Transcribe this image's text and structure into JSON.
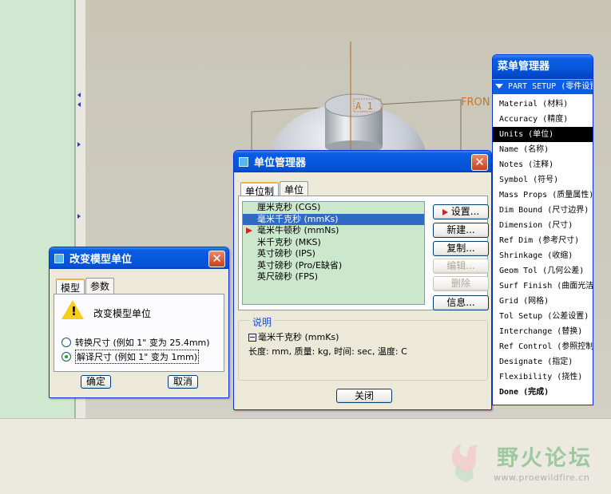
{
  "model_view": {
    "datum_axis_label": "A_1",
    "datum_plane_label": "FRON"
  },
  "change_units_dialog": {
    "title": "改变模型单位",
    "tabs": [
      "模型",
      "参数"
    ],
    "heading": "改变模型单位",
    "options": [
      {
        "label": "转换尺寸 (例如 1\" 变为 25.4mm)",
        "selected": false
      },
      {
        "label": "解译尺寸 (例如 1\" 变为 1mm)",
        "selected": true
      }
    ],
    "ok_label": "确定",
    "cancel_label": "取消"
  },
  "units_manager": {
    "title": "单位管理器",
    "tabs": [
      "单位制",
      "单位"
    ],
    "systems": [
      {
        "label": "厘米克秒 (CGS)",
        "selected": false,
        "current": false
      },
      {
        "label": "毫米千克秒 (mmKs)",
        "selected": true,
        "current": false
      },
      {
        "label": "毫米牛顿秒 (mmNs)",
        "selected": false,
        "current": true
      },
      {
        "label": "米千克秒 (MKS)",
        "selected": false,
        "current": false
      },
      {
        "label": "英寸磅秒 (IPS)",
        "selected": false,
        "current": false
      },
      {
        "label": "英寸磅秒 (Pro/E缺省)",
        "selected": false,
        "current": false
      },
      {
        "label": "英尺磅秒 (FPS)",
        "selected": false,
        "current": false
      }
    ],
    "buttons": {
      "set": "设置...",
      "new": "新建...",
      "copy": "复制...",
      "edit": "编辑...",
      "delete": "删除",
      "info": "信息..."
    },
    "description_title": "说明",
    "description_system": "毫米千克秒 (mmKs)",
    "description_detail": "长度: mm, 质量: kg, 时间: sec, 温度: C",
    "close_label": "关闭"
  },
  "menu_manager": {
    "title": "菜单管理器",
    "header": "PART SETUP (零件设置)",
    "items": [
      {
        "label": "Material (材料)",
        "highlighted": false,
        "bold": false
      },
      {
        "label": "Accuracy (精度)",
        "highlighted": false,
        "bold": false
      },
      {
        "label": "Units (单位)",
        "highlighted": true,
        "bold": false
      },
      {
        "label": "Name (名称)",
        "highlighted": false,
        "bold": false
      },
      {
        "label": "Notes (注释)",
        "highlighted": false,
        "bold": false
      },
      {
        "label": "Symbol (符号)",
        "highlighted": false,
        "bold": false
      },
      {
        "label": "Mass Props (质量属性)",
        "highlighted": false,
        "bold": false
      },
      {
        "label": "Dim Bound (尺寸边界)",
        "highlighted": false,
        "bold": false
      },
      {
        "label": "Dimension (尺寸)",
        "highlighted": false,
        "bold": false
      },
      {
        "label": "Ref Dim (参考尺寸)",
        "highlighted": false,
        "bold": false
      },
      {
        "label": "Shrinkage (收缩)",
        "highlighted": false,
        "bold": false
      },
      {
        "label": "Geom Tol (几何公差)",
        "highlighted": false,
        "bold": false
      },
      {
        "label": "Surf Finish (曲面光洁度)",
        "highlighted": false,
        "bold": false
      },
      {
        "label": "Grid (网格)",
        "highlighted": false,
        "bold": false
      },
      {
        "label": "Tol Setup (公差设置)",
        "highlighted": false,
        "bold": false
      },
      {
        "label": "Interchange (替换)",
        "highlighted": false,
        "bold": false
      },
      {
        "label": "Ref Control (参照控制)",
        "highlighted": false,
        "bold": false
      },
      {
        "label": "Designate (指定)",
        "highlighted": false,
        "bold": false
      },
      {
        "label": "Flexibility (挠性)",
        "highlighted": false,
        "bold": false
      },
      {
        "label": "Done (完成)",
        "highlighted": false,
        "bold": true
      }
    ]
  },
  "watermark": {
    "title": "野火论坛",
    "url": "www.proewildfire.cn"
  }
}
